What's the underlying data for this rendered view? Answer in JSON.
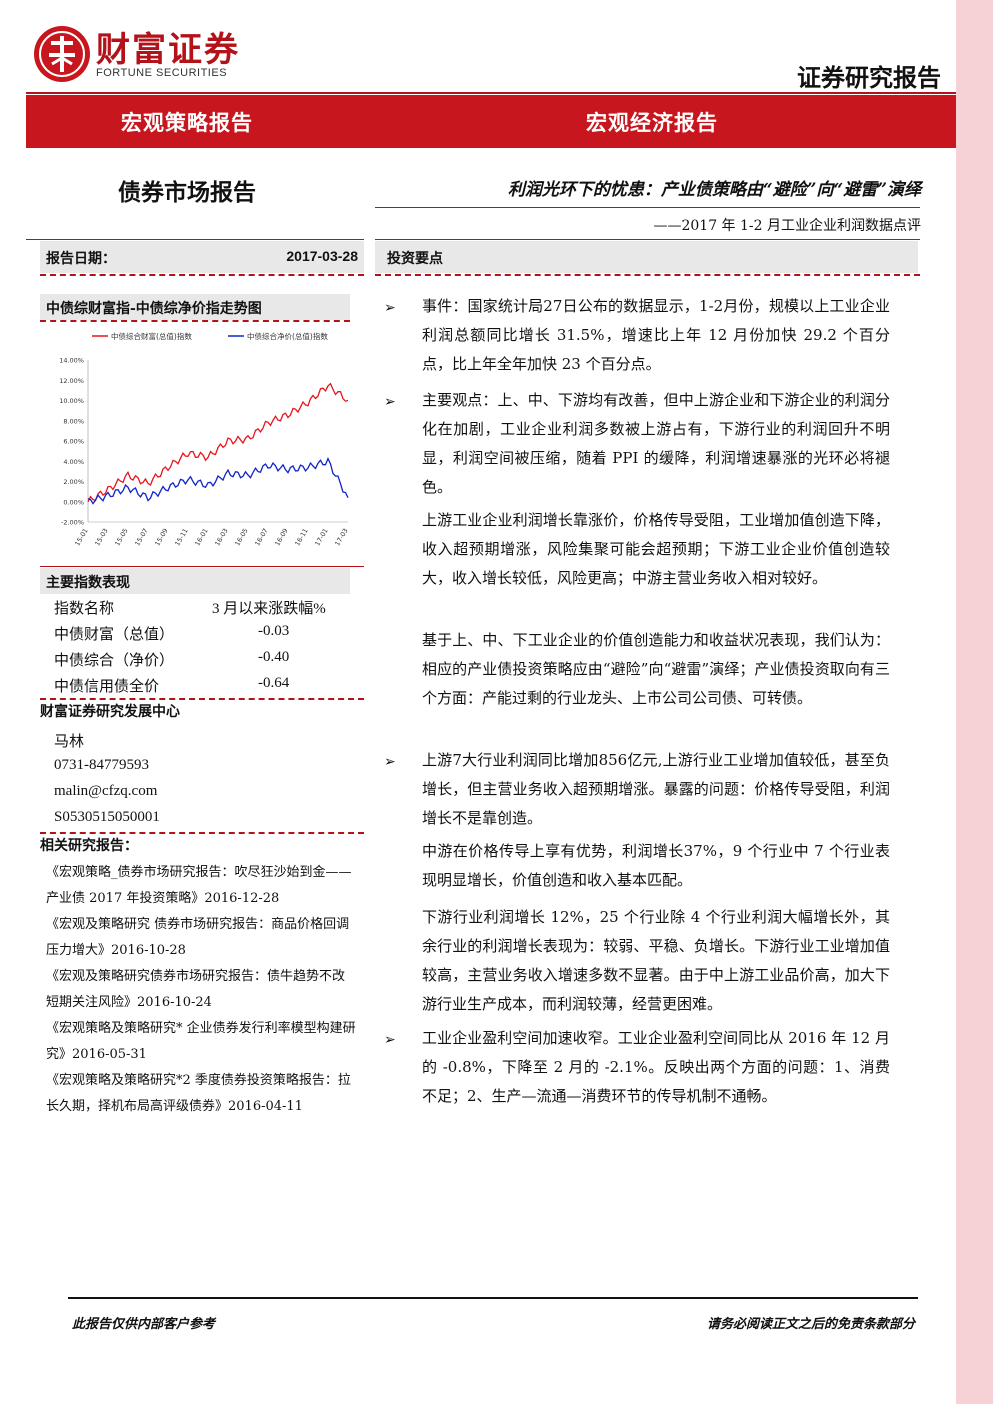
{
  "header": {
    "brand_cn": "财富证券",
    "brand_en": "FORTUNE SECURITIES",
    "report_type": "证券研究报告",
    "banner_left": "宏观策略报告",
    "banner_right": "宏观经济报告"
  },
  "titles": {
    "section": "债券市场报告",
    "main": "利润光环下的忧患：产业债策略由“避险”向“避雷”演绎",
    "subtitle": "——2017 年 1-2 月工业企业利润数据点评"
  },
  "report_date": {
    "label": "报告日期：",
    "value": "2017-03-28"
  },
  "investment_header": "投资要点",
  "chart_section_title": "中债综财富指-中债综净价指走势图",
  "chart_data": {
    "type": "line",
    "legend": [
      "中债综合财富(总值)指数",
      "中债综合净价(总值)指数"
    ],
    "x_ticks": [
      "15-01",
      "15-03",
      "15-05",
      "15-07",
      "15-09",
      "15-11",
      "16-01",
      "16-03",
      "16-05",
      "16-07",
      "16-09",
      "16-11",
      "17-01",
      "17-03"
    ],
    "y_ticks": [
      "14.00%",
      "12.00%",
      "10.00%",
      "8.00%",
      "6.00%",
      "4.00%",
      "2.00%",
      "0.00%",
      "-2.00%"
    ],
    "ylim": [
      -2,
      14
    ],
    "series": [
      {
        "name": "中债综合财富(总值)指数",
        "color": "#e8141c",
        "values": [
          0.0,
          1.2,
          2.6,
          1.8,
          3.4,
          4.8,
          4.4,
          6.0,
          6.2,
          7.8,
          8.6,
          9.8,
          11.5,
          10.0
        ]
      },
      {
        "name": "中债综合净价(总值)指数",
        "color": "#1024c8",
        "values": [
          0.0,
          0.6,
          1.4,
          0.4,
          1.4,
          2.2,
          1.6,
          2.8,
          2.6,
          3.6,
          3.2,
          3.4,
          4.0,
          0.4
        ]
      }
    ]
  },
  "index_table": {
    "title": "主要指数表现",
    "header": [
      "指数名称",
      "3 月以来涨跌幅%"
    ],
    "rows": [
      [
        "中债财富（总值）",
        "-0.03"
      ],
      [
        "中债综合（净价）",
        "-0.40"
      ],
      [
        "中债信用债全价",
        "-0.64"
      ]
    ]
  },
  "research_center": {
    "title": "财富证券研究发展中心",
    "name": "马林",
    "phone": "0731-84779593",
    "email": "malin@cfzq.com",
    "license": "S0530515050001"
  },
  "related_reports": {
    "title": "相关研究报告：",
    "items": [
      "《宏观策略_债券市场研究报告：吹尽狂沙始到金——产业债 2017 年投资策略》2016-12-28",
      "《宏观及策略研究 债券市场研究报告：商品价格回调压力增大》2016-10-28",
      "《宏观及策略研究债券市场研究报告：债牛趋势不改 短期关注风险》2016-10-24",
      "《宏观策略及策略研究* 企业债券发行利率模型构建研究》2016-05-31",
      "《宏观策略及策略研究*2 季度债券投资策略报告：拉长久期，择机布局高评级债券》2016-04-11"
    ]
  },
  "bullet_symbol": "➢",
  "body": {
    "p1": "事件：国家统计局27日公布的数据显示，1-2月份，规模以上工业企业利润总额同比增长 31.5%，增速比上年 12 月份加快 29.2 个百分点，比上年全年加快 23 个百分点。",
    "p2": "主要观点：上、中、下游均有改善，但中上游企业和下游企业的利润分化在加剧，工业企业利润多数被上游占有，下游行业的利润回升不明显，利润空间被压缩，随着 PPI 的缓降，利润增速暴涨的光环必将褪色。",
    "p3": "上游工业企业利润增长靠涨价，价格传导受阻，工业增加值创造下降，收入超预期增涨，风险集聚可能会超预期；下游工业企业价值创造较大，收入增长较低，风险更高；中游主营业务收入相对较好。",
    "p4": "基于上、中、下工业企业的价值创造能力和收益状况表现，我们认为：相应的产业债投资策略应由“避险”向“避雷”演绎；产业债投资取向有三个方面：产能过剩的行业龙头、上市公司公司债、可转债。",
    "p5": "上游7大行业利润同比增加856亿元,上游行业工业增加值较低，甚至负增长，但主营业务收入超预期增涨。暴露的问题：价格传导受阻，利润增长不是靠创造。",
    "p6": "中游在价格传导上享有优势，利润增长37%，9 个行业中 7 个行业表现明显增长，价值创造和收入基本匹配。",
    "p7": "下游行业利润增长 12%，25 个行业除 4 个行业利润大幅增长外，其余行业的利润增长表现为：较弱、平稳、负增长。下游行业工业增加值较高，主营业务收入增速多数不显著。由于中上游工业品价高，加大下游行业生产成本，而利润较薄，经营更困难。",
    "p8": "工业企业盈利空间加速收窄。工业企业盈利空间同比从 2016 年 12 月的 -0.8%，下降至 2 月的 -2.1%。反映出两个方面的问题：1、消费不足；2、生产—流通—消费环节的传导机制不通畅。"
  },
  "footer": {
    "left": "此报告仅供内部客户参考",
    "right": "请务必阅读正文之后的免责条款部分"
  }
}
